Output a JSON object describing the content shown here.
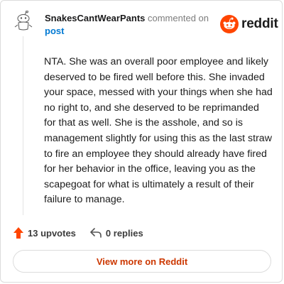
{
  "comment": {
    "username": "SnakesCantWearPants",
    "commented_on_text": "commented on",
    "post_link_text": "post",
    "body": "NTA. She was an overall poor employee and likely deserved to be fired well before this. She invaded your space, messed with your things when she had no right to, and she deserved to be reprimanded for that as well. She is the asshole, and so is management slightly for using this as the last straw to fire an employee they should already have fired for her behavior in the office, leaving you as the scapegoat for what is ultimately a result of their failure to manage.",
    "upvotes_label": "13 upvotes",
    "replies_label": "0 replies"
  },
  "logo": {
    "wordmark": "reddit"
  },
  "footer": {
    "view_button_label": "View more on Reddit"
  },
  "icons": {
    "avatar": "snoo-avatar-icon",
    "logo": "reddit-snoo-icon",
    "upvote": "upvote-arrow-icon",
    "reply": "reply-arrow-icon"
  },
  "colors": {
    "brand_orange": "#ff4500",
    "link_blue": "#0079d3",
    "button_text": "#cc3700"
  }
}
